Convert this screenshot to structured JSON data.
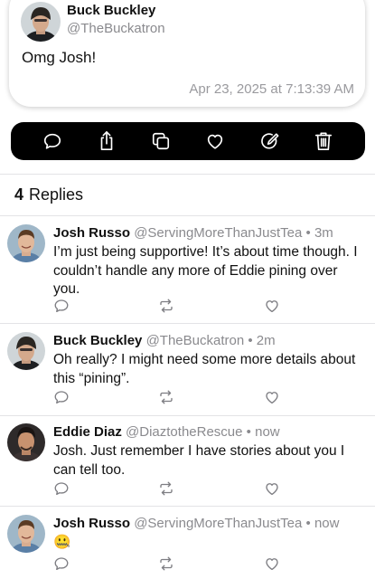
{
  "post": {
    "author_name": "Buck Buckley",
    "author_handle": "@TheBuckatron",
    "text": "Omg Josh!",
    "timestamp": "Apr 23, 2025 at 7:13:39 AM"
  },
  "action_bar": {
    "icons": [
      "reply-icon",
      "share-icon",
      "copy-icon",
      "like-icon",
      "edit-icon",
      "delete-icon"
    ]
  },
  "replies_header": {
    "count": "4",
    "label": "Replies"
  },
  "replies": [
    {
      "name": "Josh Russo",
      "handle": "@ServingMoreThanJustTea",
      "time": "3m",
      "text": "I’m just being supportive! It’s about time though. I couldn’t handle any more of Eddie pining over you."
    },
    {
      "name": "Buck Buckley",
      "handle": "@TheBuckatron",
      "time": "2m",
      "text": "Oh really? I might need some more details about this “pining”."
    },
    {
      "name": "Eddie Diaz",
      "handle": "@DiaztotheRescue",
      "time": "now",
      "text": "Josh. Just remember I have stories about you I can tell too."
    },
    {
      "name": "Josh Russo",
      "handle": "@ServingMoreThanJustTea",
      "time": "now",
      "text": "🤐"
    }
  ],
  "separator": "•",
  "colors": {
    "handle_gray": "#8a8a8e",
    "icon_gray": "#7d7d82",
    "bar_bg": "#000000"
  }
}
